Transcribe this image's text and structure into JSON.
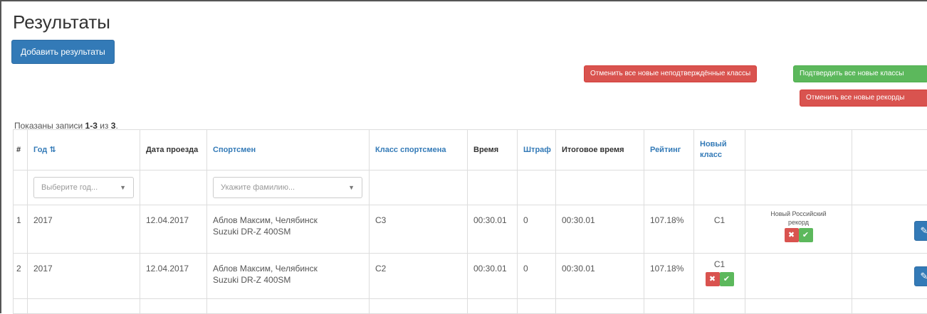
{
  "page": {
    "title": "Результаты"
  },
  "actions": {
    "add_results": "Добавить результаты",
    "cancel_unconfirmed_classes": "Отменить все новые неподтверждённые классы",
    "confirm_new_classes": "Подтвердить все новые классы",
    "cancel_new_records": "Отменить все новые рекорды"
  },
  "summary": {
    "prefix": "Показаны записи ",
    "range": "1-3",
    "middle": " из ",
    "total": "3",
    "suffix": "."
  },
  "table": {
    "headers": {
      "num": "#",
      "year": "Год",
      "date": "Дата проезда",
      "athlete": "Спортсмен",
      "athlete_class": "Класс спортсмена",
      "time": "Время",
      "penalty": "Штраф",
      "total_time": "Итоговое время",
      "rating": "Рейтинг",
      "new_class": "Новый класс"
    },
    "filters": {
      "year_placeholder": "Выберите год...",
      "athlete_placeholder": "Укажите фамилию..."
    },
    "rows": [
      {
        "num": "1",
        "year": "2017",
        "date": "12.04.2017",
        "athlete": "Аблов Максим, Челябинск",
        "vehicle": "Suzuki DR-Z 400SM",
        "athlete_class": "C3",
        "time": "00:30.01",
        "penalty": "0",
        "total_time": "00:30.01",
        "rating": "107.18%",
        "new_class": "C1",
        "status": "Новый Российский рекорд"
      },
      {
        "num": "2",
        "year": "2017",
        "date": "12.04.2017",
        "athlete": "Аблов Максим, Челябинск",
        "vehicle": "Suzuki DR-Z 400SM",
        "athlete_class": "C2",
        "time": "00:30.01",
        "penalty": "0",
        "total_time": "00:30.01",
        "rating": "107.18%",
        "new_class": "C1"
      }
    ]
  },
  "colors": {
    "primary": "#337ab7",
    "danger": "#d9534f",
    "success": "#5cb85c"
  }
}
